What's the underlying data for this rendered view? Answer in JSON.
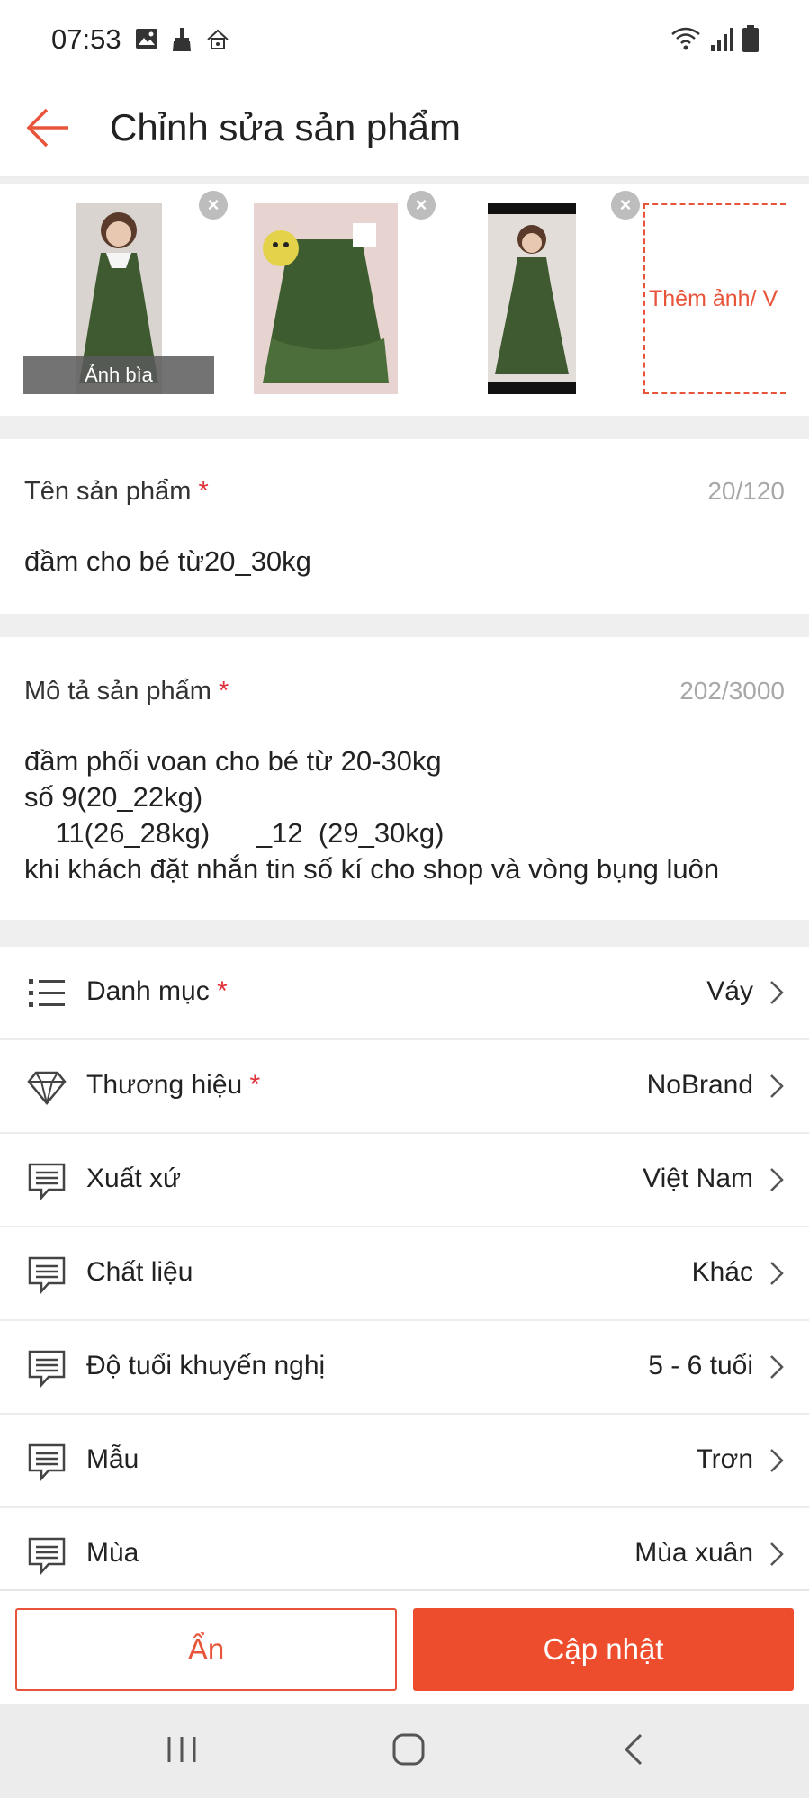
{
  "status_bar": {
    "time": "07:53"
  },
  "header": {
    "title": "Chỉnh sửa sản phẩm"
  },
  "media": {
    "cover_label": "Ảnh bìa",
    "add_label": "Thêm ảnh/ V"
  },
  "product_name": {
    "label": "Tên sản phẩm",
    "required_mark": "*",
    "counter": "20/120",
    "value": "đầm cho bé từ20_30kg"
  },
  "description": {
    "label": "Mô tả sản phẩm",
    "required_mark": "*",
    "counter": "202/3000",
    "lines": [
      "đầm phối voan cho bé từ 20-30kg",
      "số 9(20_22kg)",
      "    11(26_28kg)      _12  (29_30kg)",
      "khi khách đặt nhắn tin số kí cho shop và vòng bụng luôn"
    ]
  },
  "attributes": [
    {
      "label": "Danh mục",
      "required": "*",
      "value": "Váy",
      "icon": "list-icon"
    },
    {
      "label": "Thương hiệu",
      "required": "*",
      "value": "NoBrand",
      "icon": "diamond-icon"
    },
    {
      "label": "Xuất xứ",
      "required": "",
      "value": "Việt Nam",
      "icon": "message-icon"
    },
    {
      "label": "Chất liệu",
      "required": "",
      "value": "Khác",
      "icon": "message-icon"
    },
    {
      "label": "Độ tuổi khuyến nghị",
      "required": "",
      "value": "5 - 6 tuổi",
      "icon": "message-icon"
    },
    {
      "label": "Mẫu",
      "required": "",
      "value": "Trơn",
      "icon": "message-icon"
    },
    {
      "label": "Mùa",
      "required": "",
      "value": "Mùa xuân",
      "icon": "message-icon"
    }
  ],
  "actions": {
    "hide_label": "Ẩn",
    "update_label": "Cập nhật"
  },
  "colors": {
    "accent": "#ee4d2d",
    "required": "#e0303a"
  }
}
